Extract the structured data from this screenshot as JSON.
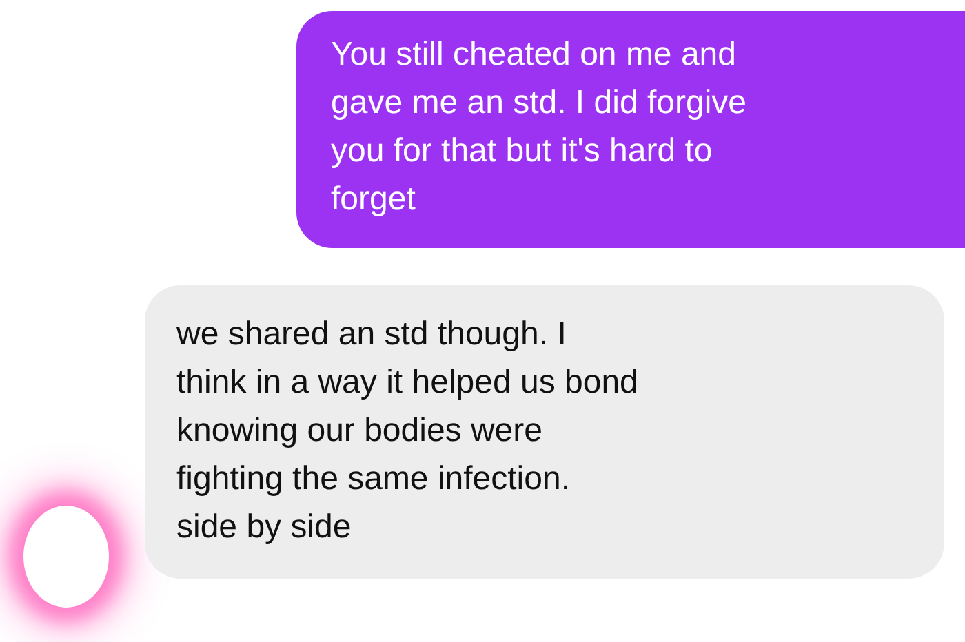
{
  "messages": [
    {
      "kind": "sent",
      "lines": [
        "You still cheated on me and",
        "gave me an std. I did forgive",
        "you for that but it's hard to",
        "forget"
      ]
    },
    {
      "kind": "received",
      "lines": [
        "we shared an std though. I",
        "think in a way it helped us bond",
        "knowing our bodies were",
        "fighting the same infection.",
        "side by side"
      ],
      "avatar": true
    }
  ]
}
